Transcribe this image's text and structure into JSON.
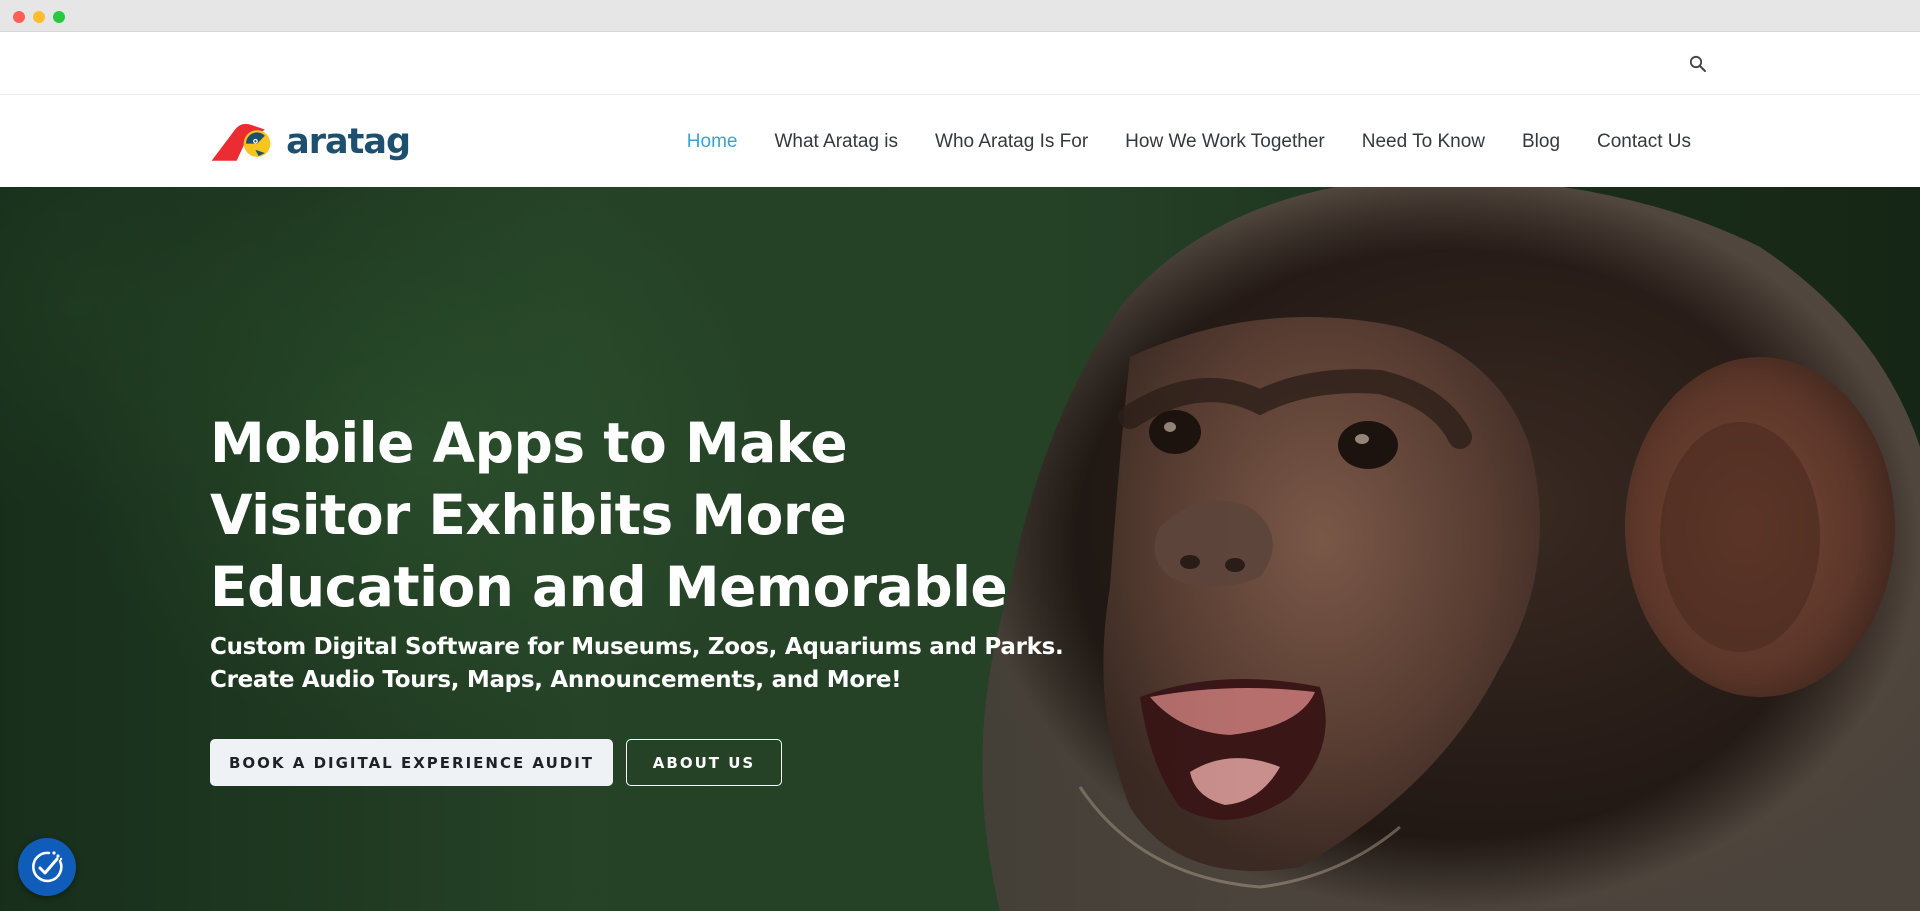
{
  "topbar": {
    "search_icon": "search-icon"
  },
  "brand": {
    "name": "aratag",
    "colors": {
      "red": "#ec2c33",
      "yellow": "#f7c51d",
      "teal": "#1d4f6e"
    }
  },
  "nav": {
    "items": [
      {
        "label": "Home",
        "active": true
      },
      {
        "label": "What Aratag is"
      },
      {
        "label": "Who Aratag Is For"
      },
      {
        "label": "How We Work Together"
      },
      {
        "label": "Need To Know"
      },
      {
        "label": "Blog"
      },
      {
        "label": "Contact Us"
      }
    ],
    "active_color": "#3aa4cf"
  },
  "hero": {
    "title_lines": [
      "Mobile Apps to Make",
      "Visitor Exhibits More",
      "Education and Memorable"
    ],
    "subtitle_lines": [
      "Custom Digital Software for Museums, Zoos, Aquariums and Parks.",
      "Create Audio Tours, Maps, Announcements, and More!"
    ],
    "primary_button": "BOOK A DIGITAL EXPERIENCE AUDIT",
    "secondary_button": "ABOUT US"
  },
  "accessibility": {
    "icon": "accessibility-icon",
    "color": "#0f5db8"
  }
}
